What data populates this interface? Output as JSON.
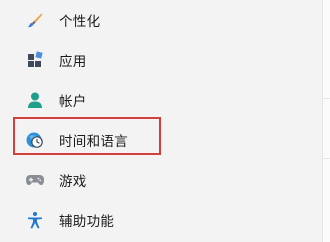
{
  "nav": {
    "items": [
      {
        "label": "个性化",
        "icon": "brush-icon"
      },
      {
        "label": "应用",
        "icon": "apps-icon"
      },
      {
        "label": "帐户",
        "icon": "account-icon"
      },
      {
        "label": "时间和语言",
        "icon": "clock-globe-icon"
      },
      {
        "label": "游戏",
        "icon": "gamepad-icon"
      },
      {
        "label": "辅助功能",
        "icon": "accessibility-icon"
      }
    ]
  },
  "colors": {
    "highlight_border": "#d23f3f",
    "background": "#f3f3f3"
  }
}
